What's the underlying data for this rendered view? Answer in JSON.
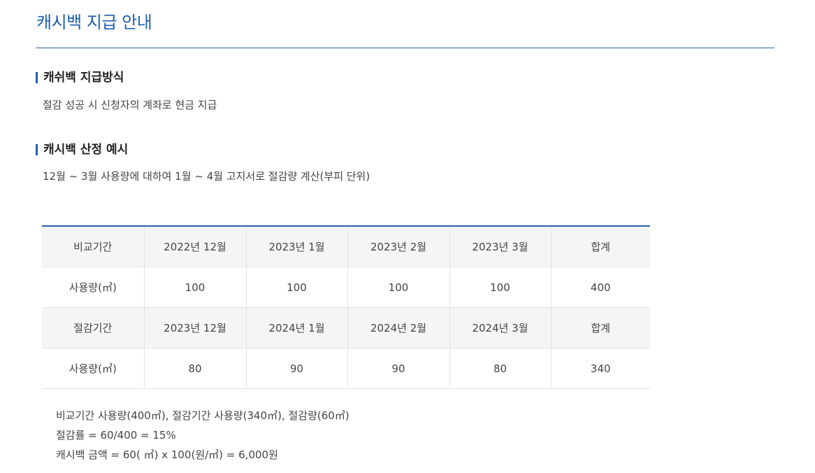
{
  "page": {
    "title": "캐시백 지급 안내"
  },
  "sections": [
    {
      "heading": "캐쉬백 지급방식",
      "text": "절감 성공 시 신청자의 계좌로 현금 지급"
    },
    {
      "heading": "캐시백 산정 예시",
      "text": "12월 ~ 3월 사용량에 대하여 1월 ~ 4월 고지서로 절감량 계산(부피 단위)"
    }
  ],
  "table": {
    "rows": [
      {
        "type": "head",
        "cells": [
          "비교기간",
          "2022년 12월",
          "2023년 1월",
          "2023년 2월",
          "2023년 3월",
          "합계"
        ]
      },
      {
        "type": "data",
        "cells": [
          "사용량(㎥)",
          "100",
          "100",
          "100",
          "100",
          "400"
        ]
      },
      {
        "type": "head",
        "cells": [
          "절감기간",
          "2023년 12월",
          "2024년 1월",
          "2024년 2월",
          "2024년 3월",
          "합계"
        ]
      },
      {
        "type": "data",
        "cells": [
          "사용량(㎥)",
          "80",
          "90",
          "90",
          "80",
          "340"
        ]
      }
    ]
  },
  "notes": [
    "비교기간 사용량(400㎥), 절감기간 사용량(340㎥), 절감량(60㎥)",
    "절감률 = 60/400 = 15%",
    "캐시백 금액 = 60( ㎥) x 100(원/㎥) = 6,000원"
  ]
}
